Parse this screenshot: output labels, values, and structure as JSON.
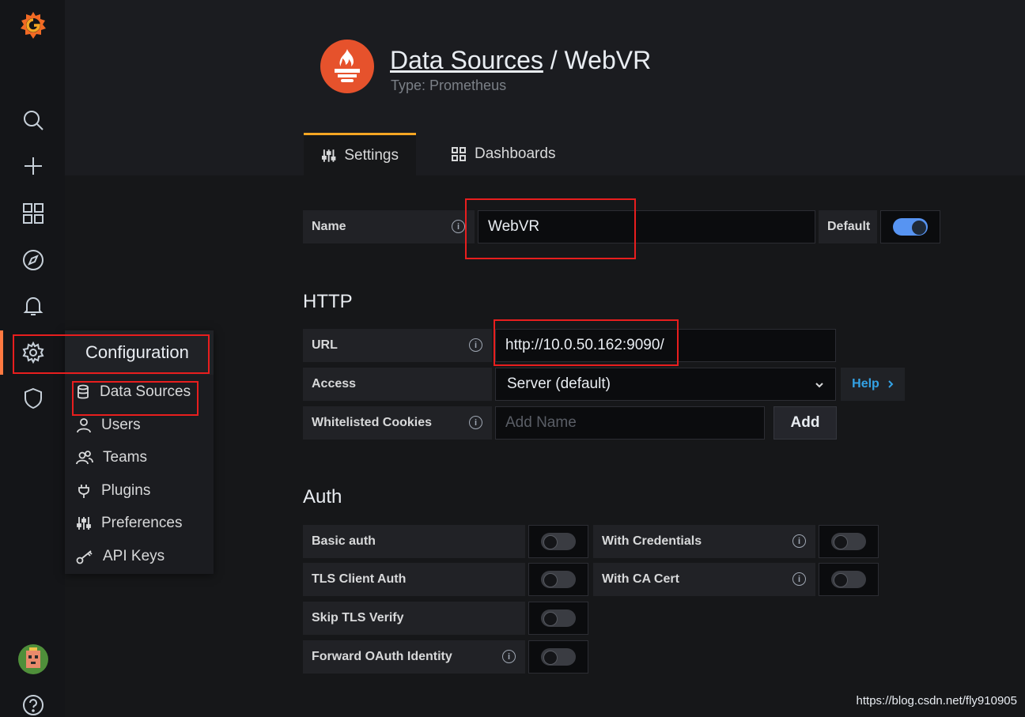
{
  "header": {
    "breadcrumb_link": "Data Sources",
    "separator": " / ",
    "datasource_name": "WebVR",
    "type_text": "Type: Prometheus",
    "logo_icon": "prometheus-logo-icon",
    "logo_color": "#e6522c"
  },
  "tabs": [
    {
      "label": "Settings",
      "icon": "sliders-icon",
      "active": true
    },
    {
      "label": "Dashboards",
      "icon": "apps-icon",
      "active": false
    }
  ],
  "name_row": {
    "label": "Name",
    "value": "WebVR",
    "default_label": "Default",
    "default_on": true
  },
  "http": {
    "title": "HTTP",
    "url_label": "URL",
    "url_value": "http://10.0.50.162:9090/",
    "access_label": "Access",
    "access_value": "Server (default)",
    "help_label": "Help",
    "cookies_label": "Whitelisted Cookies",
    "cookies_placeholder": "Add Name",
    "add_label": "Add"
  },
  "auth": {
    "title": "Auth",
    "basic_auth": "Basic auth",
    "with_credentials": "With Credentials",
    "tls_client_auth": "TLS Client Auth",
    "with_ca_cert": "With CA Cert",
    "skip_tls_verify": "Skip TLS Verify",
    "forward_oauth": "Forward OAuth Identity"
  },
  "config_menu": {
    "title": "Configuration",
    "items": [
      {
        "label": "Data Sources",
        "icon": "database-icon"
      },
      {
        "label": "Users",
        "icon": "user-icon"
      },
      {
        "label": "Teams",
        "icon": "users-icon"
      },
      {
        "label": "Plugins",
        "icon": "plug-icon"
      },
      {
        "label": "Preferences",
        "icon": "sliders-icon"
      },
      {
        "label": "API Keys",
        "icon": "key-icon"
      }
    ]
  },
  "colors": {
    "accent": "#ff7941",
    "tab_active": "#f5a623",
    "highlight": "#e81e1e",
    "link": "#33a2e5",
    "switch_on": "#5794f2"
  },
  "watermark": "https://blog.csdn.net/fly910905"
}
